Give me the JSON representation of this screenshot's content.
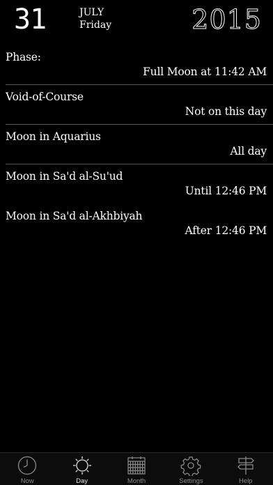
{
  "header": {
    "day_number": "31",
    "month": "JULY",
    "weekday": "Friday",
    "year": "2015"
  },
  "rows": [
    {
      "label": "Phase:",
      "value": "Full Moon at 11:42 AM"
    },
    {
      "label": "Void-of-Course",
      "value": "Not on this day"
    },
    {
      "label": "Moon in Aquarius",
      "value": "All day"
    },
    {
      "label": "Moon in Sa'd al-Su'ud",
      "value": "Until 12:46 PM"
    },
    {
      "label": "Moon in Sa'd al-Akhbiyah",
      "value": "After 12:46 PM"
    }
  ],
  "tabbar": {
    "tabs": [
      {
        "label": "Now",
        "icon": "clock-icon"
      },
      {
        "label": "Day",
        "icon": "sun-icon",
        "active": true
      },
      {
        "label": "Month",
        "icon": "calendar-icon"
      },
      {
        "label": "Settings",
        "icon": "gear-icon"
      },
      {
        "label": "Help",
        "icon": "signpost-icon"
      }
    ]
  },
  "colors": {
    "background": "#000000",
    "text": "#ffffff",
    "separator": "#555555",
    "tab_inactive": "#8a8a8a",
    "tab_active": "#e0e0e0"
  }
}
